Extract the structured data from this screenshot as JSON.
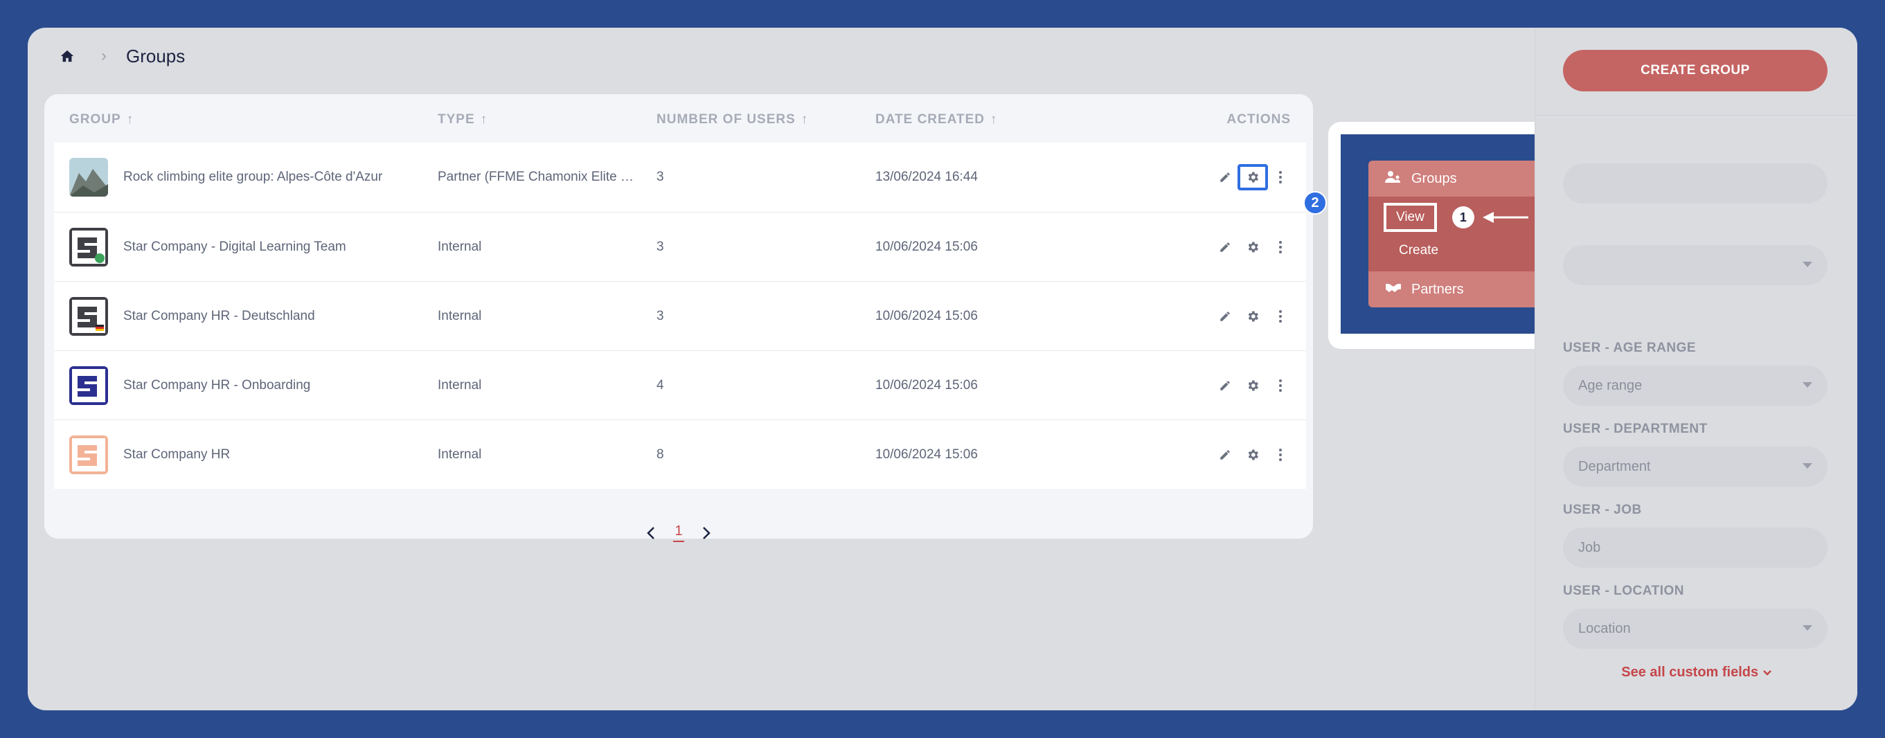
{
  "breadcrumb": {
    "home_icon": "home-icon",
    "title": "Groups"
  },
  "table": {
    "headers": {
      "group": "GROUP",
      "type": "TYPE",
      "users": "NUMBER OF USERS",
      "date": "DATE CREATED",
      "actions": "ACTIONS"
    },
    "rows": [
      {
        "name": "Rock climbing elite group: Alpes-Côte d'Azur",
        "type": "Partner (FFME Chamonix Elite Climbing)",
        "users": "3",
        "date": "13/06/2024 16:44"
      },
      {
        "name": "Star Company - Digital Learning Team",
        "type": "Internal",
        "users": "3",
        "date": "10/06/2024 15:06"
      },
      {
        "name": "Star Company HR - Deutschland",
        "type": "Internal",
        "users": "3",
        "date": "10/06/2024 15:06"
      },
      {
        "name": "Star Company HR - Onboarding",
        "type": "Internal",
        "users": "4",
        "date": "10/06/2024 15:06"
      },
      {
        "name": "Star Company HR",
        "type": "Internal",
        "users": "8",
        "date": "10/06/2024 15:06"
      }
    ]
  },
  "pagination": {
    "current": "1"
  },
  "annotations": {
    "step1": "1",
    "step2": "2"
  },
  "menu": {
    "groups_label": "Groups",
    "view_label": "View",
    "create_label": "Create",
    "partners_label": "Partners"
  },
  "sidebar": {
    "create_button": "CREATE GROUP",
    "age_label": "USER - AGE RANGE",
    "age_placeholder": "Age range",
    "dept_label": "USER - DEPARTMENT",
    "dept_placeholder": "Department",
    "job_label": "USER - JOB",
    "job_placeholder": "Job",
    "loc_label": "USER - LOCATION",
    "loc_placeholder": "Location",
    "see_all": "See all custom fields"
  },
  "colors": {
    "accent": "#c56563",
    "highlight": "#2f6ee0",
    "background": "#2a4c8e"
  }
}
